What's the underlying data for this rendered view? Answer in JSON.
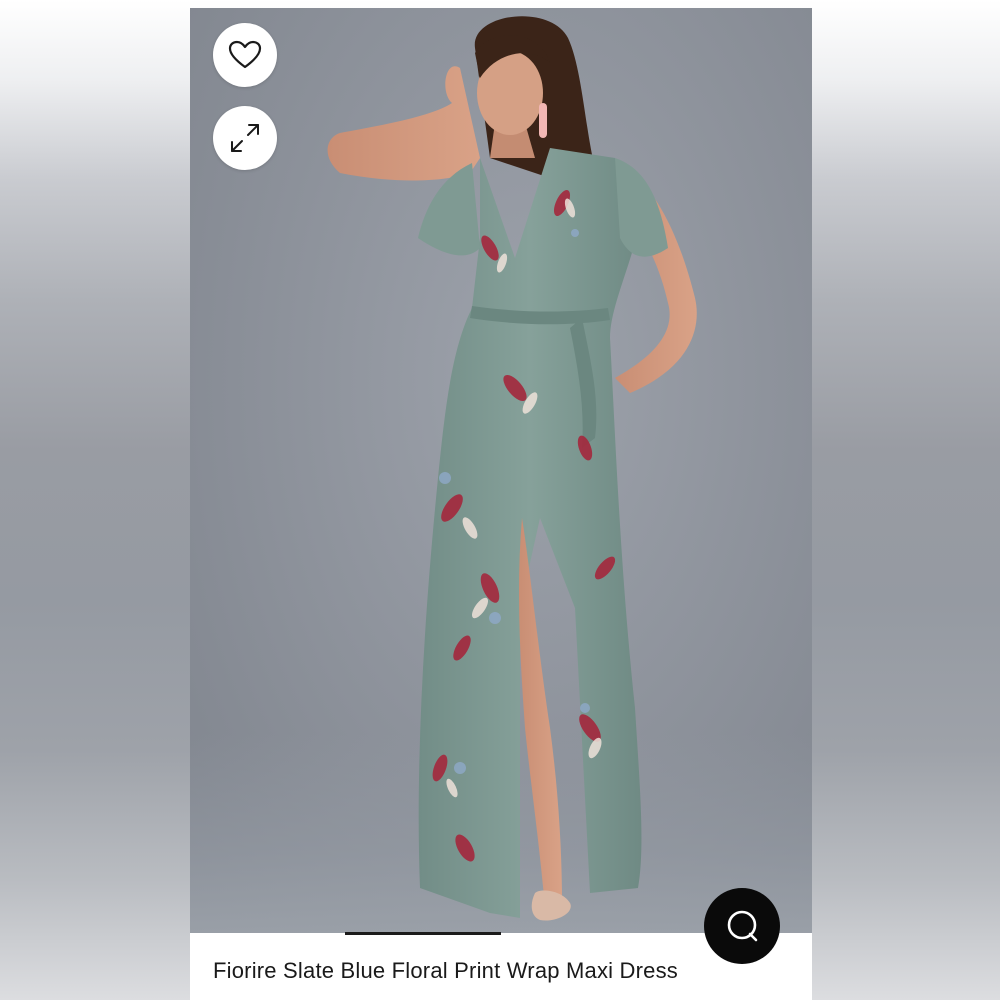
{
  "product": {
    "title": "Fiorire Slate Blue Floral Print Wrap Maxi Dress"
  },
  "actions": {
    "favorite_icon": "heart-outline-icon",
    "expand_icon": "expand-arrows-icon",
    "chat_icon": "chat-bubble-icon"
  },
  "image": {
    "subject": "model wearing dress",
    "carousel_active_index": 1
  },
  "colors": {
    "background": "#8f949d",
    "dress": "#7f9a93",
    "accent_floral": "#a4283d",
    "chat_button": "#0a0a0a"
  }
}
